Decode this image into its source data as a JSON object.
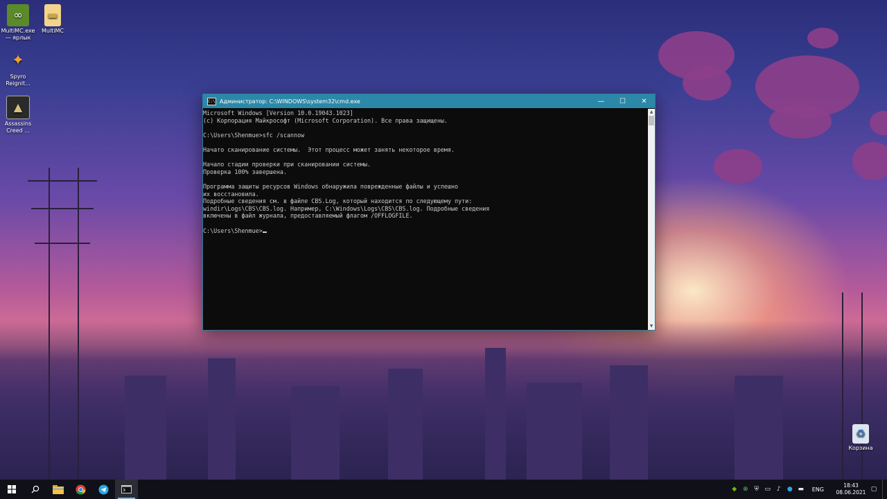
{
  "desktop": {
    "icons": [
      {
        "label": "MultiMC.exe — ярлык",
        "icon": "multimc-icon"
      },
      {
        "label": "MultiMC",
        "icon": "folder-icon"
      },
      {
        "label": "Spyro Reignit...",
        "icon": "spyro-icon"
      },
      {
        "label": "Assassins Creed ...",
        "icon": "assassins-creed-icon"
      },
      {
        "label": "Корзина",
        "icon": "recycle-bin-icon"
      }
    ]
  },
  "cmd": {
    "title": "Администратор: C:\\WINDOWS\\system32\\cmd.exe",
    "lines": [
      "Microsoft Windows [Version 10.0.19043.1023]",
      "(c) Корпорация Майкрософт (Microsoft Corporation). Все права защищены.",
      "",
      "C:\\Users\\Shenmue>sfc /scannow",
      "",
      "Начато сканирование системы.  Этот процесс может занять некоторое время.",
      "",
      "Начало стадии проверки при сканировании системы.",
      "Проверка 100% завершена.",
      "",
      "Программа защиты ресурсов Windows обнаружила поврежденные файлы и успешно",
      "их восстановила.",
      "Подробные сведения см. в файле CBS.Log, который находится по следующему пути:",
      "windir\\Logs\\CBS\\CBS.log. Например, C:\\Windows\\Logs\\CBS\\CBS.log. Подробные сведения",
      "включены в файл журнала, предоставляемый флагом /OFFLOGFILE.",
      ""
    ],
    "prompt": "C:\\Users\\Shenmue>"
  },
  "taskbar": {
    "apps": [
      "start-icon",
      "search-icon",
      "file-explorer-icon",
      "chrome-icon",
      "telegram-icon",
      "cmd-icon"
    ],
    "language": "ENG",
    "time": "18:43",
    "date": "08.06.2021"
  }
}
